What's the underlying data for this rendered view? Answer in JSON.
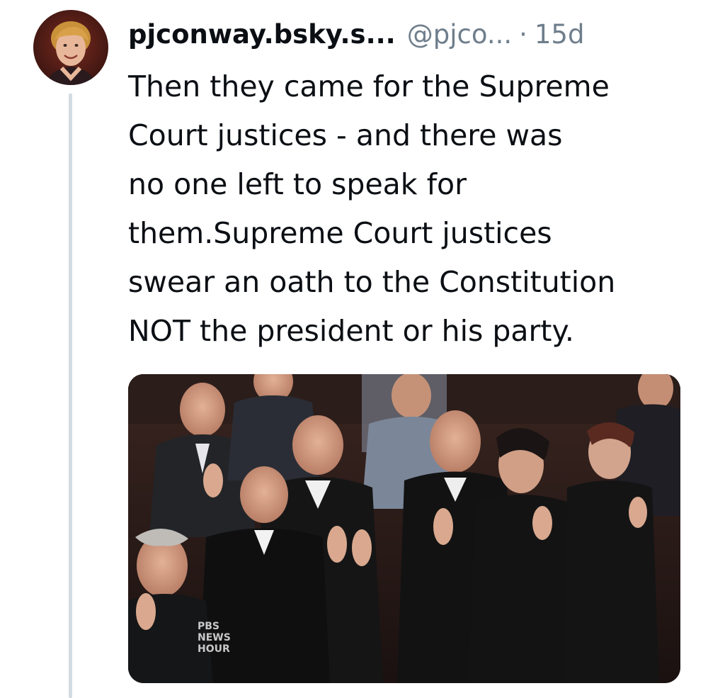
{
  "post": {
    "author": {
      "display_name": "pjconway.bsky.s...",
      "handle": "@pjco...",
      "avatar_icon": "profile-photo"
    },
    "separator": "·",
    "timestamp": "15d",
    "text": "Then they came for the Supreme\nCourt justices - and there was\nno one left to speak for\nthem.Supreme Court justices\nswear an oath to the Constitution\nNOT the president or his party.",
    "media": {
      "type": "gif",
      "subject": "Supreme Court justices applauding",
      "watermark": "PBS NEWS HOUR"
    }
  },
  "colors": {
    "text_primary": "#0b0f14",
    "text_secondary": "#6f7e8c",
    "thread_line": "#d4dbe2",
    "background": "#ffffff"
  }
}
